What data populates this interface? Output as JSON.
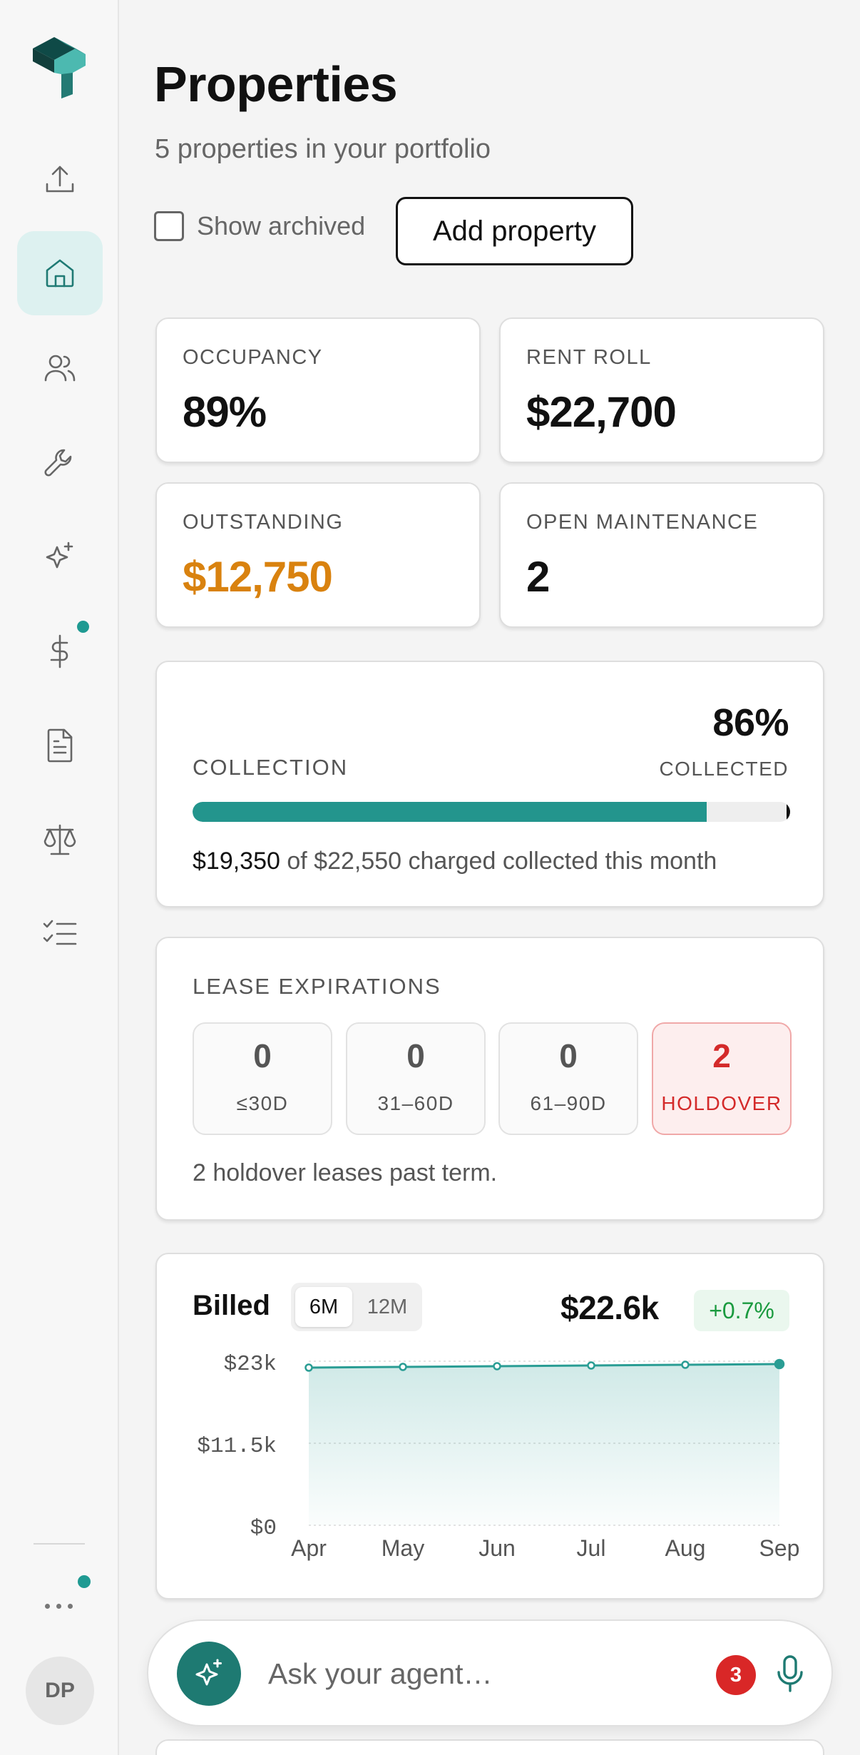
{
  "sidebar": {
    "items": [
      {
        "icon": "upload-icon",
        "active": false
      },
      {
        "icon": "home-icon",
        "active": true
      },
      {
        "icon": "users-icon",
        "active": false
      },
      {
        "icon": "wrench-icon",
        "active": false
      },
      {
        "icon": "sparkle-icon",
        "active": false
      },
      {
        "icon": "dollar-icon",
        "active": false,
        "notification": true
      },
      {
        "icon": "document-icon",
        "active": false
      },
      {
        "icon": "scale-icon",
        "active": false
      },
      {
        "icon": "checklist-icon",
        "active": false
      }
    ],
    "avatar_initials": "DP"
  },
  "header": {
    "title": "Properties",
    "subtitle": "5 properties in your portfolio",
    "show_archived_label": "Show archived",
    "show_archived_checked": false,
    "add_button": "Add property"
  },
  "stats": {
    "occupancy": {
      "label": "OCCUPANCY",
      "value": "89%"
    },
    "rent_roll": {
      "label": "RENT ROLL",
      "value": "$22,700"
    },
    "outstanding": {
      "label": "OUTSTANDING",
      "value": "$12,750",
      "color": "#d9820f"
    },
    "open_maintenance": {
      "label": "OPEN MAINTENANCE",
      "value": "2"
    }
  },
  "collection": {
    "label": "COLLECTION",
    "percent": "86%",
    "percent_label": "COLLECTED",
    "progress": 0.86,
    "collected_amount": "$19,350",
    "summary_rest": "of $22,550 charged collected this month"
  },
  "lease_expirations": {
    "label": "LEASE EXPIRATIONS",
    "buckets": [
      {
        "count": "0",
        "label": "≤30D"
      },
      {
        "count": "0",
        "label": "31–60D"
      },
      {
        "count": "0",
        "label": "61–90D"
      },
      {
        "count": "2",
        "label": "HOLDOVER"
      }
    ],
    "note": "2 holdover leases past term."
  },
  "billed": {
    "title": "Billed",
    "ranges": [
      "6M",
      "12M"
    ],
    "selected_range": "6M",
    "total": "$22.6k",
    "delta": "+0.7%"
  },
  "chart_data": {
    "type": "area",
    "x": [
      "Apr",
      "May",
      "Jun",
      "Jul",
      "Aug",
      "Sep"
    ],
    "y_tick_labels": [
      "$23k",
      "$11.5k",
      "$0"
    ],
    "ylim": [
      0,
      23000
    ],
    "series": [
      {
        "values": [
          22100,
          22200,
          22300,
          22400,
          22500,
          22600
        ]
      }
    ],
    "grid": true,
    "line_color": "#2a9d94"
  },
  "agent": {
    "placeholder": "Ask your agent…",
    "notification_count": "3"
  }
}
